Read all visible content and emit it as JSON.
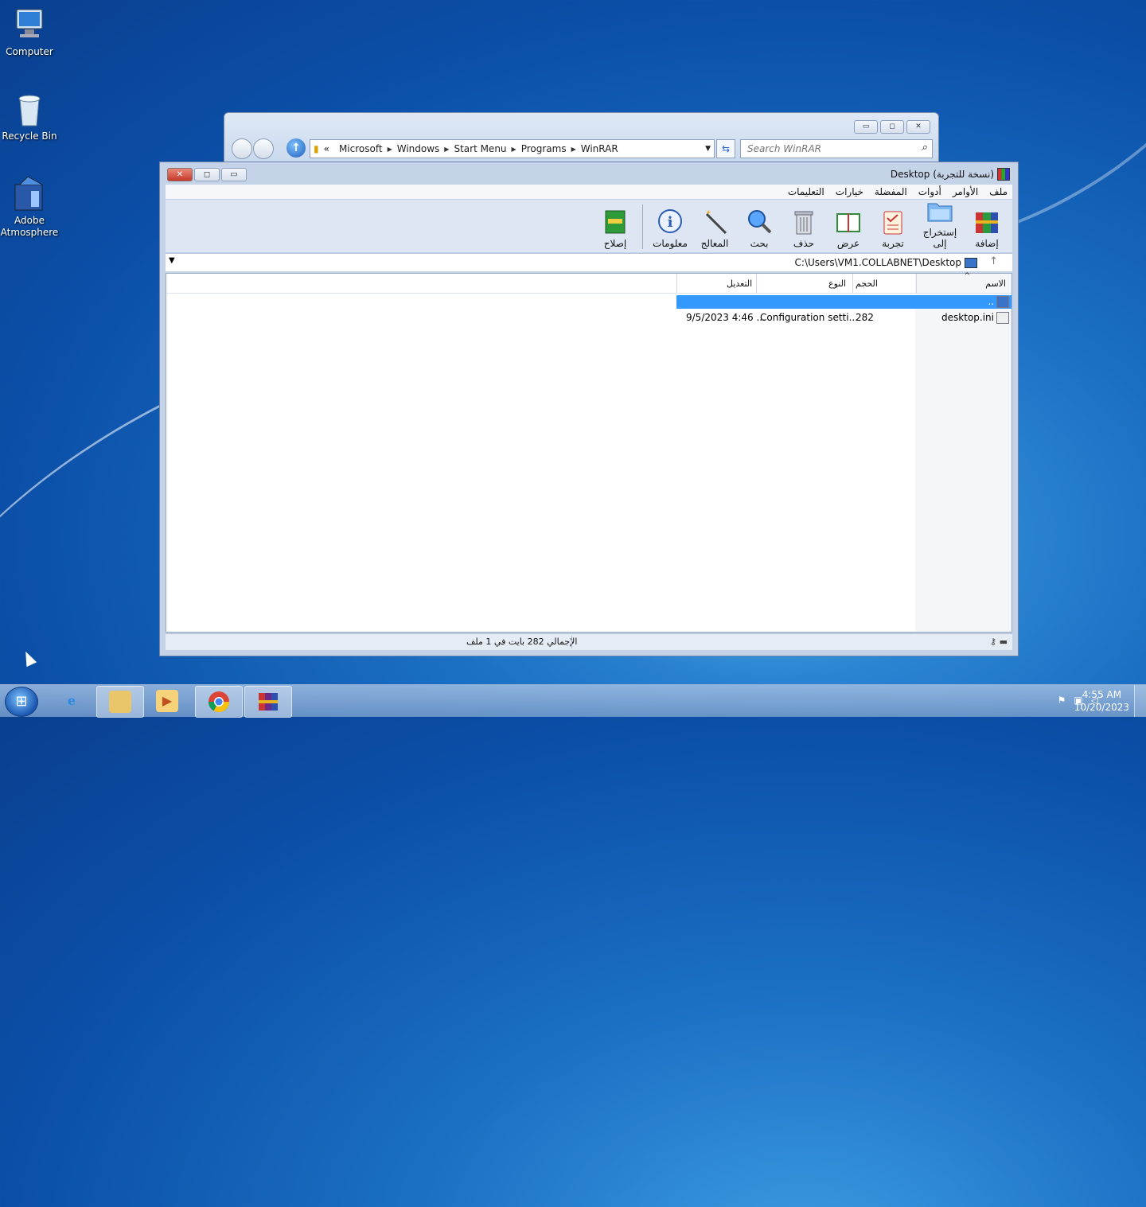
{
  "desktop": {
    "icons": [
      {
        "label": "Computer",
        "icon": "computer-icon"
      },
      {
        "label": "Recycle Bin",
        "icon": "recycle-bin-icon"
      },
      {
        "label": "Adobe Atmosphere",
        "icon": "adobe-atmosphere-icon"
      }
    ]
  },
  "explorer": {
    "breadcrumb": [
      "«",
      "Microsoft",
      "Windows",
      "Start Menu",
      "Programs",
      "WinRAR"
    ],
    "search_placeholder": "Search WinRAR"
  },
  "winrar": {
    "title": "Desktop (نسخة للتجربة)",
    "menu": [
      "ملف",
      "الأوامر",
      "أدوات",
      "المفضلة",
      "خيارات",
      "التعليمات"
    ],
    "toolbar": [
      {
        "label": "إضافة",
        "icon": "add-archive-icon"
      },
      {
        "label": "إستخراج إلى",
        "icon": "extract-folder-icon"
      },
      {
        "label": "تجربة",
        "icon": "test-clipboard-icon"
      },
      {
        "label": "عرض",
        "icon": "view-book-icon"
      },
      {
        "label": "حذف",
        "icon": "trash-icon"
      },
      {
        "label": "بحث",
        "icon": "magnifier-icon"
      },
      {
        "label": "المعالج",
        "icon": "wizard-wand-icon"
      },
      {
        "label": "معلومات",
        "icon": "info-icon"
      },
      {
        "label": "إصلاح",
        "icon": "repair-kit-icon"
      }
    ],
    "path": "C:\\Users\\VM1.COLLABNET\\Desktop",
    "columns": {
      "name": "الاسم",
      "size": "الحجم",
      "type": "النوع",
      "modified": "التعديل"
    },
    "rows": [
      {
        "name": "..",
        "size": "",
        "type": "",
        "modified": ""
      },
      {
        "name": "desktop.ini",
        "size": "282",
        "type": "Configuration setti...",
        "modified": "9/5/2023 4:46 ..."
      }
    ],
    "status": "الإجمالي 282 بايت في 1 ملف"
  },
  "taskbar": {
    "items": [
      "internet-explorer-icon",
      "file-explorer-icon",
      "media-player-icon",
      "chrome-icon",
      "winrar-icon"
    ],
    "time": "4:55 AM",
    "date": "10/20/2023"
  }
}
